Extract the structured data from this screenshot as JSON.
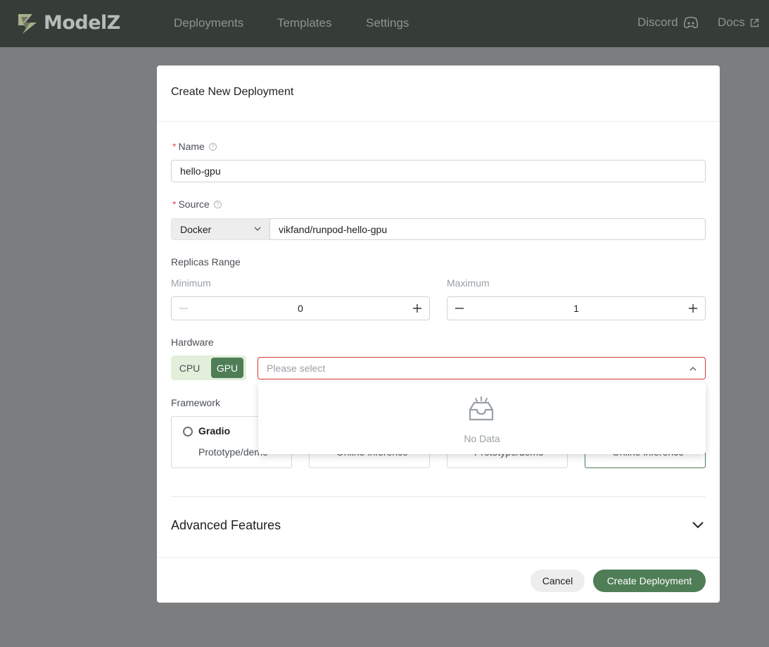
{
  "app": {
    "logo_text": "ModelZ",
    "nav": [
      "Deployments",
      "Templates",
      "Settings"
    ],
    "links": {
      "discord": "Discord",
      "docs": "Docs"
    }
  },
  "modal": {
    "title": "Create New Deployment",
    "name": {
      "label": "Name",
      "value": "hello-gpu"
    },
    "source": {
      "label": "Source",
      "type": "Docker",
      "value": "vikfand/runpod-hello-gpu"
    },
    "replicas": {
      "label": "Replicas Range",
      "min_label": "Minimum",
      "min_value": "0",
      "max_label": "Maximum",
      "max_value": "1"
    },
    "hardware": {
      "label": "Hardware",
      "options": [
        "CPU",
        "GPU"
      ],
      "selected": "GPU",
      "placeholder": "Please select",
      "dropdown_empty": "No Data"
    },
    "framework": {
      "label": "Framework",
      "cards": [
        {
          "title": "Gradio",
          "desc": "Prototype/demo"
        },
        {
          "title": "",
          "desc": "Online inference"
        },
        {
          "title": "",
          "desc": "Prototype/demo"
        },
        {
          "title": "",
          "desc": "Online inference"
        }
      ]
    },
    "advanced": "Advanced Features",
    "buttons": {
      "cancel": "Cancel",
      "create": "Create Deployment"
    }
  },
  "colors": {
    "primary": "#4e7d56",
    "error": "#d9343a",
    "nav_bg": "#363d39"
  }
}
